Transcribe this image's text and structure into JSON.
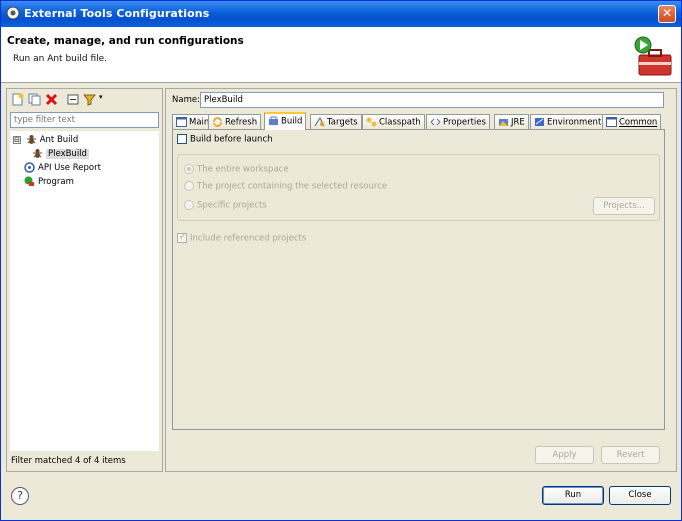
{
  "window": {
    "title": "External Tools Configurations",
    "close_glyph": "✕"
  },
  "banner": {
    "heading": "Create, manage, and run configurations",
    "subtitle": "Run an Ant build file."
  },
  "left": {
    "filter_placeholder": "type filter text",
    "tree": [
      {
        "label": "Ant Build",
        "expander": "⊟"
      },
      {
        "label": "PlexBuild"
      },
      {
        "label": "API Use Report"
      },
      {
        "label": "Program"
      }
    ],
    "status": "Filter matched 4 of 4 items"
  },
  "right": {
    "name_label": "Name:",
    "name_value": "PlexBuild",
    "tabs": [
      {
        "label": "Main"
      },
      {
        "label": "Refresh"
      },
      {
        "label": "Build"
      },
      {
        "label": "Targets"
      },
      {
        "label": "Classpath"
      },
      {
        "label": "Properties"
      },
      {
        "label": "JRE"
      },
      {
        "label": "Environment"
      },
      {
        "label": "Common"
      }
    ],
    "build_before_launch": "Build before launch",
    "radios": [
      "The entire workspace",
      "The project containing the selected resource",
      "Specific projects"
    ],
    "projects_button": "Projects...",
    "include_referenced": "Include referenced projects",
    "include_tick": "✓",
    "apply_button": "Apply",
    "revert_button": "Revert"
  },
  "footer": {
    "help_glyph": "?",
    "run_button": "Run",
    "close_button": "Close"
  }
}
